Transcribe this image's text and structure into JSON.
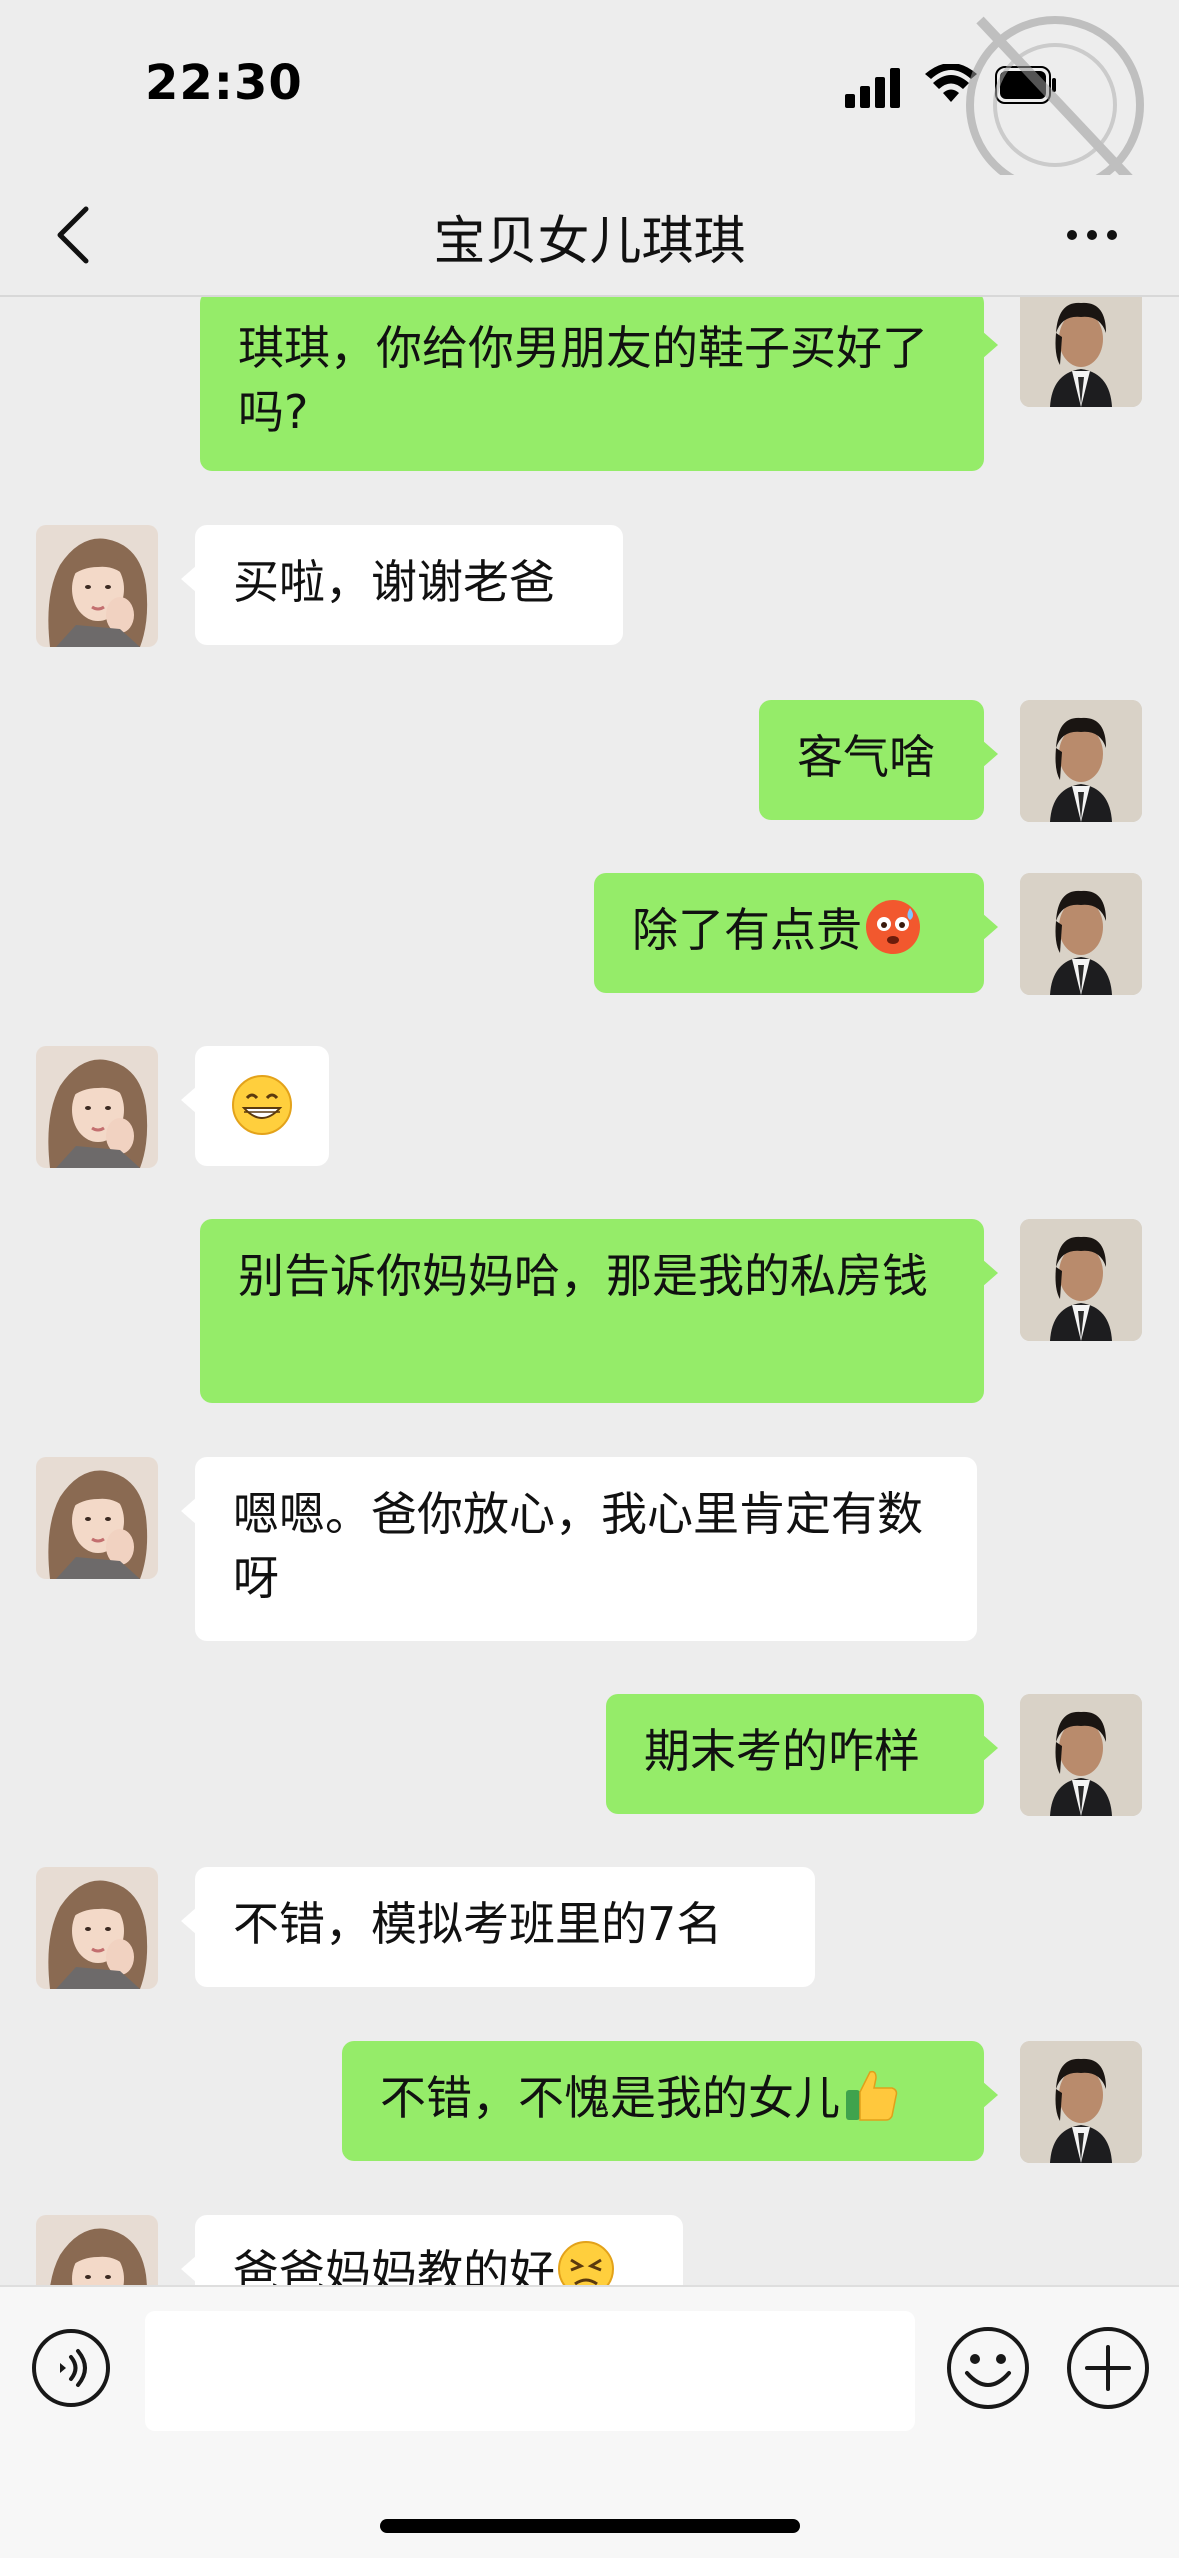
{
  "status_bar": {
    "time": "22:30",
    "icons": [
      "signal-icon",
      "wifi-icon",
      "battery-icon"
    ]
  },
  "nav": {
    "title": "宝贝女儿琪琪",
    "back_icon": "chevron-left-icon",
    "more_icon": "more-dots-icon"
  },
  "messages": [
    {
      "side": "right",
      "sender": "dad",
      "text": "琪琪，你给你男朋友的鞋子买好了吗?"
    },
    {
      "side": "left",
      "sender": "daughter",
      "text": "买啦，谢谢老爸"
    },
    {
      "side": "right",
      "sender": "dad",
      "text": "客气啥"
    },
    {
      "side": "right",
      "sender": "dad",
      "text": "除了有点贵",
      "emoji": "hot-face-emoji"
    },
    {
      "side": "left",
      "sender": "daughter",
      "text": "",
      "emoji": "grinning-face-emoji"
    },
    {
      "side": "right",
      "sender": "dad",
      "text": "别告诉你妈妈哈，那是我的私房钱"
    },
    {
      "side": "left",
      "sender": "daughter",
      "text": "嗯嗯。爸你放心，我心里肯定有数呀"
    },
    {
      "side": "right",
      "sender": "dad",
      "text": "期末考的咋样"
    },
    {
      "side": "left",
      "sender": "daughter",
      "text": "不错，模拟考班里的7名"
    },
    {
      "side": "right",
      "sender": "dad",
      "text": "不错，不愧是我的女儿",
      "emoji": "thumbs-up-emoji"
    },
    {
      "side": "left",
      "sender": "daughter",
      "text": "爸爸妈妈教的好",
      "emoji": "persevering-face-emoji"
    }
  ],
  "input_bar": {
    "voice_icon": "voice-icon",
    "input_value": "",
    "emoji_icon": "smiley-icon",
    "plus_icon": "plus-circle-icon"
  },
  "colors": {
    "background": "#ededed",
    "outgoing_bubble": "#95ec69",
    "incoming_bubble": "#ffffff",
    "input_bar": "#f7f7f7"
  }
}
